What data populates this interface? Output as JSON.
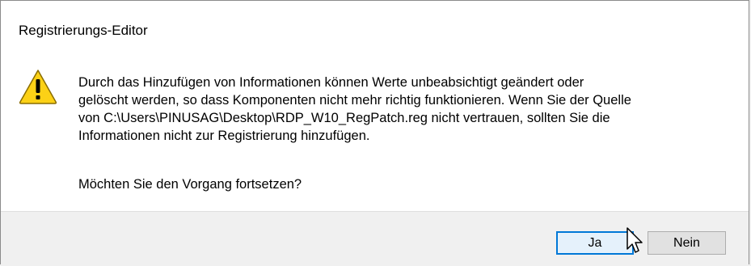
{
  "window": {
    "title": "Registrierungs-Editor"
  },
  "icon": {
    "name": "warning-icon",
    "fill": "#fcd116",
    "stroke": "#8a6d00"
  },
  "message": {
    "lines": [
      "Durch das Hinzufügen von Informationen können Werte unbeabsichtigt geändert oder",
      "gelöscht werden, so dass Komponenten nicht mehr richtig funktionieren. Wenn Sie der Quelle",
      "von C:\\Users\\PINUSAG\\Desktop\\RDP_W10_RegPatch.reg nicht vertrauen, sollten Sie die",
      "Informationen nicht zur Registrierung hinzufügen."
    ],
    "question": "Möchten Sie den Vorgang fortsetzen?"
  },
  "buttons": {
    "yes_label": "Ja",
    "no_label": "Nein"
  },
  "colors": {
    "focus_border": "#0078d7",
    "footer_bg": "#f0f0f0"
  }
}
